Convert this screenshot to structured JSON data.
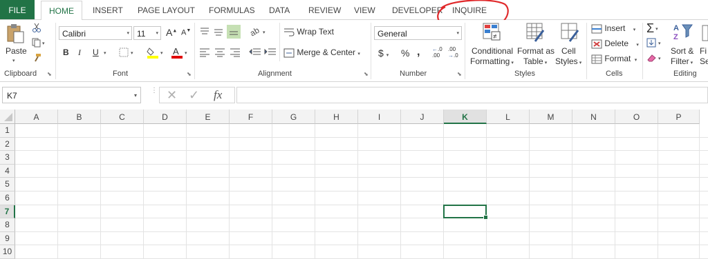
{
  "tabs": {
    "file": "FILE",
    "home": "HOME",
    "insert": "INSERT",
    "page_layout": "PAGE LAYOUT",
    "formulas": "FORMULAS",
    "data": "DATA",
    "review": "REVIEW",
    "view": "VIEW",
    "developer": "DEVELOPER",
    "inquire": "INQUIRE"
  },
  "annotation": {
    "circle_color": "#e0292b",
    "circled_item": "inquire-tab"
  },
  "clipboard": {
    "paste": "Paste",
    "group": "Clipboard"
  },
  "font": {
    "name": "Calibri",
    "size": "11",
    "bold": "B",
    "italic": "I",
    "underline": "U",
    "grow": "A",
    "shrink": "A",
    "group": "Font"
  },
  "alignment": {
    "wrap_text": "Wrap Text",
    "merge_center": "Merge & Center",
    "group": "Alignment"
  },
  "number": {
    "format": "General",
    "currency": "$",
    "percent": "%",
    "comma": ",",
    "inc_decimal": ".00",
    "dec_decimal": ".0",
    "group": "Number"
  },
  "styles": {
    "conditional_line1": "Conditional",
    "conditional_line2": "Formatting",
    "format_table_line1": "Format as",
    "format_table_line2": "Table",
    "cell_styles_line1": "Cell",
    "cell_styles_line2": "Styles",
    "group": "Styles"
  },
  "cells": {
    "insert": "Insert",
    "delete": "Delete",
    "format": "Format",
    "group": "Cells"
  },
  "editing": {
    "sort_line1": "Sort &",
    "sort_line2": "Filter",
    "find_line1": "Fi",
    "find_line2": "Sel",
    "group": "Editing"
  },
  "formula_bar": {
    "name_box": "K7",
    "fx": "fx",
    "formula": ""
  },
  "sheet": {
    "columns": [
      "A",
      "B",
      "C",
      "D",
      "E",
      "F",
      "G",
      "H",
      "I",
      "J",
      "K",
      "L",
      "M",
      "N",
      "O",
      "P"
    ],
    "rows": [
      "1",
      "2",
      "3",
      "4",
      "5",
      "6",
      "7",
      "8",
      "9",
      "10"
    ],
    "active_cell": "K7",
    "accent": "#217346"
  }
}
